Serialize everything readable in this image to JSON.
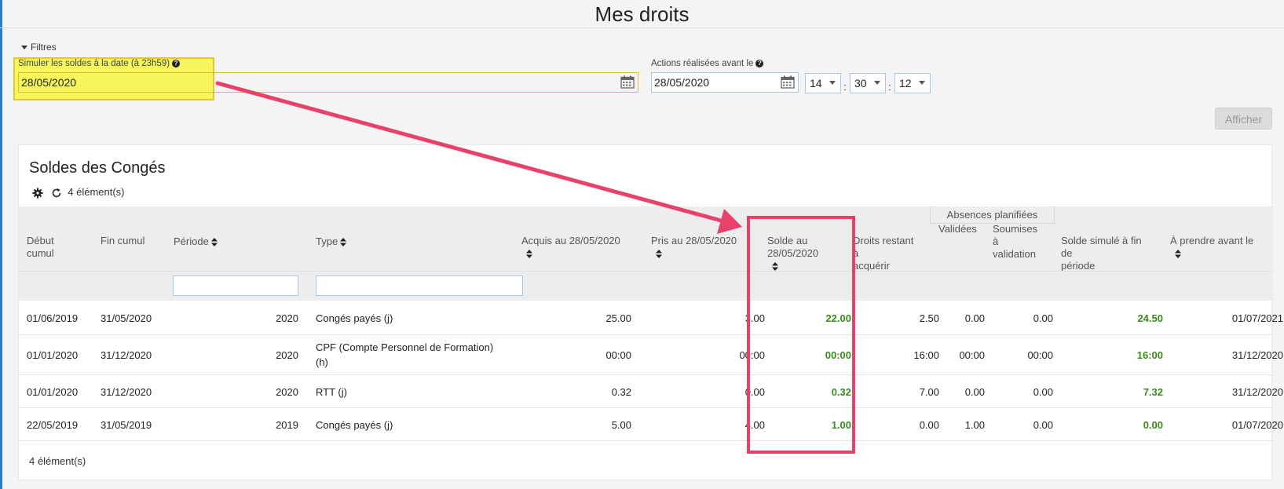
{
  "page": {
    "title": "Mes droits"
  },
  "filters": {
    "toggle_label": "Filtres",
    "simulate": {
      "label": "Simuler les soldes à la date (à 23h59)",
      "value": "28/05/2020"
    },
    "actions_before": {
      "label": "Actions réalisées avant le",
      "date": "28/05/2020",
      "hour": "14",
      "minute": "30",
      "second": "12"
    },
    "submit_label": "Afficher"
  },
  "panel": {
    "title": "Soldes des Congés",
    "count_label": "4 élément(s)",
    "footer_count": "4 élément(s)"
  },
  "table": {
    "group_header": "Absences planifiées",
    "columns": {
      "debut_l1": "Début",
      "debut_l2": "cumul",
      "fin": "Fin cumul",
      "periode": "Période",
      "type": "Type",
      "acquis": "Acquis au 28/05/2020",
      "pris": "Pris au 28/05/2020",
      "solde_l1": "Solde au",
      "solde_l2": "28/05/2020",
      "droits_l1": "Droits restant",
      "droits_l2": "à",
      "droits_l3": "acquérir",
      "validees": "Validées",
      "soumises_l1": "Soumises",
      "soumises_l2": "à",
      "soumises_l3": "validation",
      "simule_l1": "Solde simulé à fin",
      "simule_l2": "de",
      "simule_l3": "période",
      "aprendre": "À prendre avant le"
    },
    "rows": [
      {
        "debut": "01/06/2019",
        "fin": "31/05/2020",
        "periode": "2020",
        "type_l1": "Congés payés (j)",
        "type_l2": "",
        "acquis": "25.00",
        "pris": "3.00",
        "solde": "22.00",
        "droits": "2.50",
        "validees": "0.00",
        "soumises": "0.00",
        "simule": "24.50",
        "aprendre": "01/07/2021"
      },
      {
        "debut": "01/01/2020",
        "fin": "31/12/2020",
        "periode": "2020",
        "type_l1": "CPF (Compte Personnel de Formation)",
        "type_l2": "(h)",
        "acquis": "00:00",
        "pris": "00:00",
        "solde": "00:00",
        "droits": "16:00",
        "validees": "00:00",
        "soumises": "00:00",
        "simule": "16:00",
        "aprendre": "31/12/2020"
      },
      {
        "debut": "01/01/2020",
        "fin": "31/12/2020",
        "periode": "2020",
        "type_l1": "RTT (j)",
        "type_l2": "",
        "acquis": "0.32",
        "pris": "0.00",
        "solde": "0.32",
        "droits": "7.00",
        "validees": "0.00",
        "soumises": "0.00",
        "simule": "7.32",
        "aprendre": "31/12/2020"
      },
      {
        "debut": "22/05/2019",
        "fin": "31/05/2019",
        "periode": "2019",
        "type_l1": "Congés payés (j)",
        "type_l2": "",
        "acquis": "5.00",
        "pris": "4.00",
        "solde": "1.00",
        "droits": "0.00",
        "validees": "1.00",
        "soumises": "0.00",
        "simule": "0.00",
        "aprendre": "01/07/2020"
      }
    ]
  },
  "colors": {
    "accent_green": "#3a8a1e",
    "annotation_pink": "#e8416a",
    "highlight_yellow": "#f6f65a"
  }
}
